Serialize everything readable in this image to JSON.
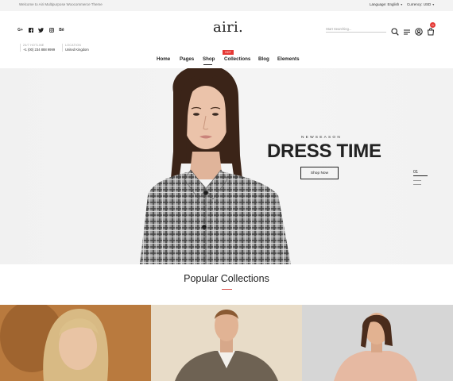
{
  "topbar": {
    "welcome": "Welcome to Airi Multipurpose Woocommerce Theme",
    "language": "Language: English",
    "currency": "Currency: USD"
  },
  "header": {
    "logo": "airi.",
    "hotline_label": "24/7 HOTLINE",
    "hotline_value": "+1 (00) 234 888 9999",
    "location_label": "LOCATION",
    "location_value": "United Kingdom",
    "search_placeholder": "Start Searching...",
    "cart_count": "0",
    "social_icons": [
      "google-plus-icon",
      "facebook-icon",
      "twitter-icon",
      "instagram-icon",
      "behance-icon"
    ]
  },
  "nav": {
    "items": [
      "Home",
      "Pages",
      "Shop",
      "Collections",
      "Blog",
      "Elements"
    ],
    "active": "Shop",
    "hot_badge": "HOT"
  },
  "hero": {
    "kicker": "NEWSEASON",
    "title": "DRESS TIME",
    "button": "Shop Now",
    "slide_number": "01"
  },
  "collections": {
    "title": "Popular Collections"
  },
  "colors": {
    "accent": "#e53935",
    "text": "#222222",
    "topbar_bg": "#f3f3f3",
    "hero_bg": "#f2f2f2"
  }
}
